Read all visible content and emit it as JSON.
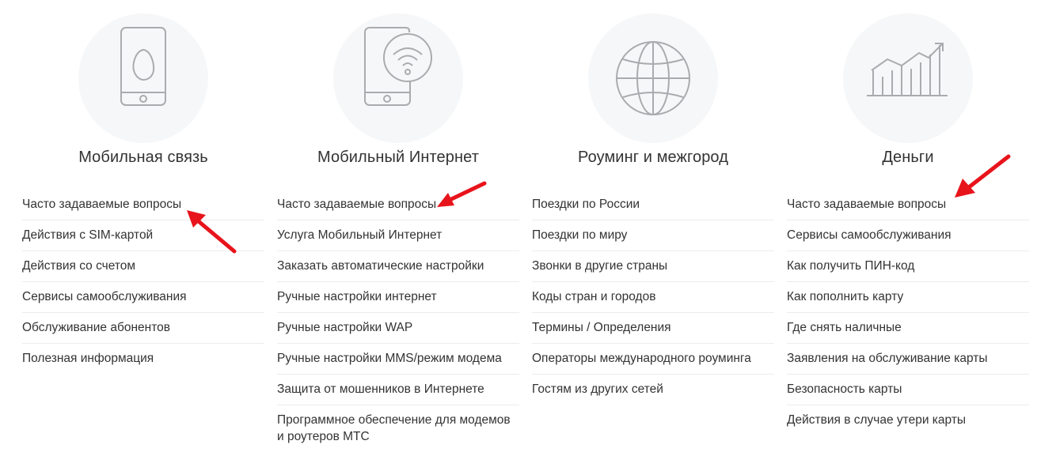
{
  "columns": [
    {
      "title": "Мобильная связь",
      "icon": "smartphone-egg-icon",
      "links": [
        "Часто задаваемые вопросы",
        "Действия с SIM-картой",
        "Действия со счетом",
        "Сервисы самообслуживания",
        "Обслуживание абонентов",
        "Полезная информация"
      ]
    },
    {
      "title": "Мобильный Интернет",
      "icon": "smartphone-wifi-icon",
      "links": [
        "Часто задаваемые вопросы",
        "Услуга Мобильный Интернет",
        "Заказать автоматические настройки",
        "Ручные настройки интернет",
        "Ручные настройки WAP",
        "Ручные настройки MMS/режим модема",
        "Защита от мошенников в Интернете",
        "Программное обеспечение для модемов и роутеров МТС"
      ]
    },
    {
      "title": "Роуминг и межгород",
      "icon": "globe-icon",
      "links": [
        "Поездки по России",
        "Поездки по миру",
        "Звонки в другие страны",
        "Коды стран и городов",
        "Термины / Определения",
        "Операторы международного роуминга",
        "Гостям из других сетей"
      ]
    },
    {
      "title": "Деньги",
      "icon": "growth-chart-icon",
      "links": [
        "Часто задаваемые вопросы",
        "Сервисы самообслуживания",
        "Как получить ПИН-код",
        "Как пополнить карту",
        "Где снять наличные",
        "Заявления на обслуживание карты",
        "Безопасность карты",
        "Действия в случае утери карты"
      ]
    }
  ],
  "colors": {
    "annotation_arrow": "#e8141b",
    "icon_stroke": "#a9acae",
    "icon_circle": "#f6f7f8"
  }
}
